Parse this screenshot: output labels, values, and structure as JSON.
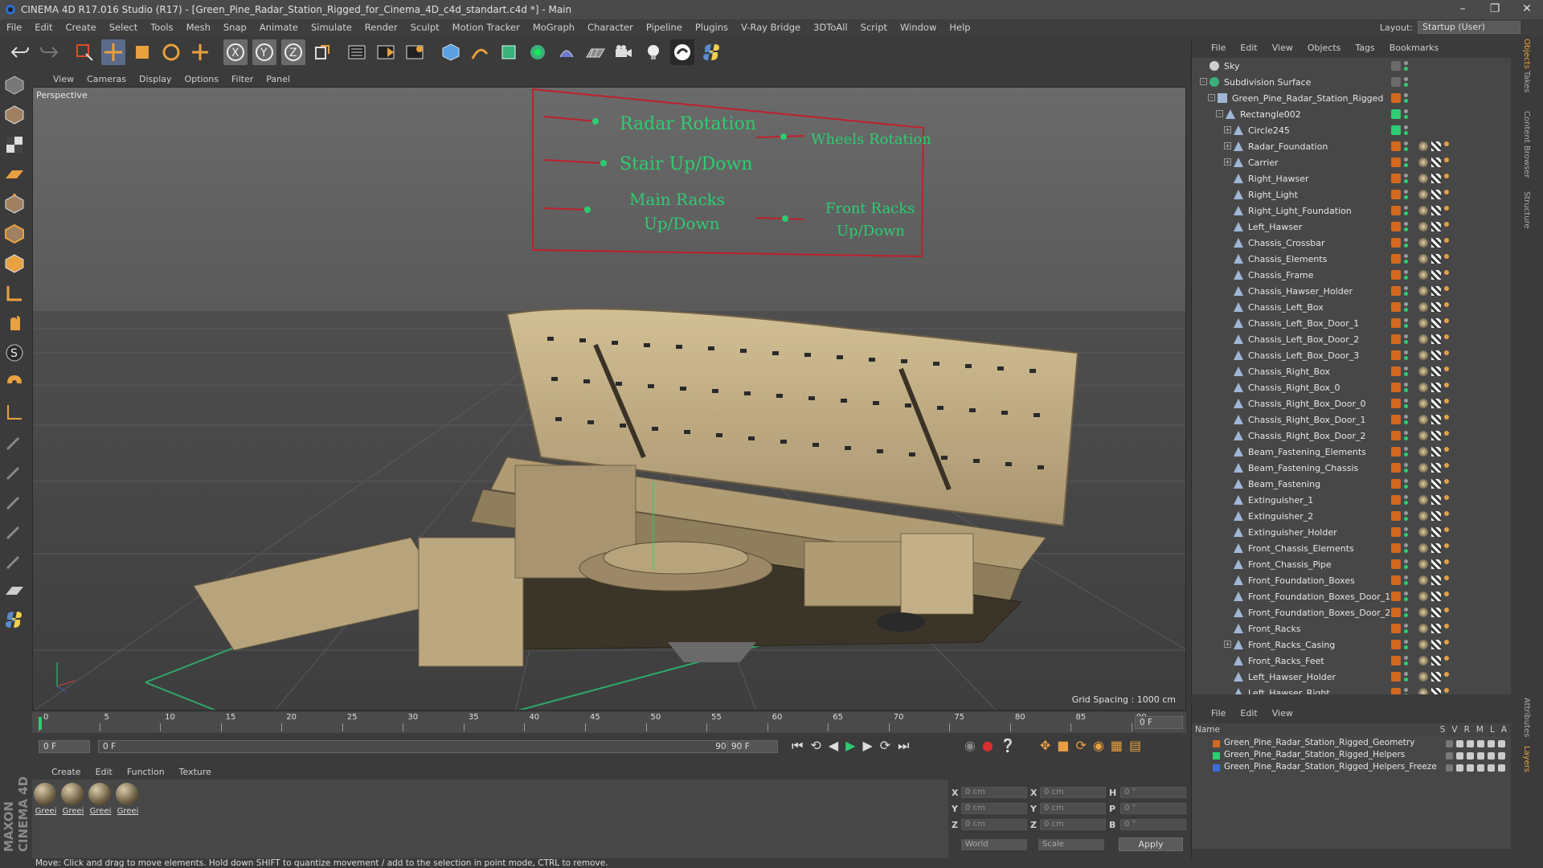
{
  "window": {
    "title": "CINEMA 4D R17.016 Studio (R17) - [Green_Pine_Radar_Station_Rigged_for_Cinema_4D_c4d_standart.c4d *] - Main"
  },
  "menu": [
    "File",
    "Edit",
    "Create",
    "Select",
    "Tools",
    "Mesh",
    "Snap",
    "Animate",
    "Simulate",
    "Render",
    "Sculpt",
    "Motion Tracker",
    "MoGraph",
    "Character",
    "Pipeline",
    "Plugins",
    "V-Ray Bridge",
    "3DToAll",
    "Script",
    "Window",
    "Help"
  ],
  "layout": {
    "label": "Layout:",
    "value": "Startup (User)"
  },
  "viewport": {
    "menu": [
      "View",
      "Cameras",
      "Display",
      "Options",
      "Filter",
      "Panel"
    ],
    "label": "Perspective",
    "grid_spacing": "Grid Spacing : 1000 cm",
    "controls": {
      "radar_rotation": "Radar Rotation",
      "wheels_rotation": "Wheels Rotation",
      "stair_updown": "Stair Up/Down",
      "main_racks_1": "Main Racks",
      "main_racks_2": "Up/Down",
      "front_racks_1": "Front Racks",
      "front_racks_2": "Up/Down"
    }
  },
  "timeline": {
    "ticks": [
      "0",
      "5",
      "10",
      "15",
      "20",
      "25",
      "30",
      "35",
      "40",
      "45",
      "50",
      "55",
      "60",
      "65",
      "70",
      "75",
      "80",
      "85",
      "90"
    ],
    "end_field": "0 F"
  },
  "transport": {
    "start": "0 F",
    "current": "0 F",
    "range_end": "90 F",
    "end": "90 F"
  },
  "materials": {
    "menu": [
      "Create",
      "Edit",
      "Function",
      "Texture"
    ],
    "items": [
      "Greei",
      "Greei",
      "Greei",
      "Greei"
    ]
  },
  "coords": {
    "x_pos": "0 cm",
    "y_pos": "0 cm",
    "z_pos": "0 cm",
    "x_size": "0 cm",
    "y_size": "0 cm",
    "z_size": "0 cm",
    "h": "0 °",
    "p": "0 °",
    "b": "0 °",
    "mode": "World",
    "size_mode": "Scale",
    "apply": "Apply",
    "labels": {
      "x": "X",
      "y": "Y",
      "z": "Z",
      "x2": "X",
      "y2": "Y",
      "z2": "Z",
      "h": "H",
      "p": "P",
      "b": "B"
    }
  },
  "objects": {
    "menu": [
      "File",
      "Edit",
      "View",
      "Objects",
      "Tags",
      "Bookmarks"
    ],
    "rows": [
      {
        "name": "Sky",
        "indent": 0,
        "color": "#6b6b6b",
        "type": "sky"
      },
      {
        "name": "Subdivision Surface",
        "indent": 0,
        "color": "#6b6b6b",
        "type": "subd",
        "expand": "-"
      },
      {
        "name": "Green_Pine_Radar_Station_Rigged",
        "indent": 1,
        "color": "#d2691e",
        "type": "null",
        "expand": "-"
      },
      {
        "name": "Rectangle002",
        "indent": 2,
        "color": "#2ecc71",
        "type": "spline",
        "expand": "-"
      },
      {
        "name": "Circle245",
        "indent": 3,
        "color": "#2ecc71",
        "type": "spline",
        "expand": "+"
      },
      {
        "name": "Radar_Foundation",
        "indent": 3,
        "color": "#d2691e",
        "type": "poly",
        "expand": "+"
      },
      {
        "name": "Carrier",
        "indent": 3,
        "color": "#d2691e",
        "type": "poly",
        "expand": "+"
      },
      {
        "name": "Right_Hawser",
        "indent": 3,
        "color": "#d2691e",
        "type": "poly"
      },
      {
        "name": "Right_Light",
        "indent": 3,
        "color": "#d2691e",
        "type": "poly"
      },
      {
        "name": "Right_Light_Foundation",
        "indent": 3,
        "color": "#d2691e",
        "type": "poly"
      },
      {
        "name": "Left_Hawser",
        "indent": 3,
        "color": "#d2691e",
        "type": "poly"
      },
      {
        "name": "Chassis_Crossbar",
        "indent": 3,
        "color": "#d2691e",
        "type": "poly"
      },
      {
        "name": "Chassis_Elements",
        "indent": 3,
        "color": "#d2691e",
        "type": "poly"
      },
      {
        "name": "Chassis_Frame",
        "indent": 3,
        "color": "#d2691e",
        "type": "poly"
      },
      {
        "name": "Chassis_Hawser_Holder",
        "indent": 3,
        "color": "#d2691e",
        "type": "poly"
      },
      {
        "name": "Chassis_Left_Box",
        "indent": 3,
        "color": "#d2691e",
        "type": "poly"
      },
      {
        "name": "Chassis_Left_Box_Door_1",
        "indent": 3,
        "color": "#d2691e",
        "type": "poly"
      },
      {
        "name": "Chassis_Left_Box_Door_2",
        "indent": 3,
        "color": "#d2691e",
        "type": "poly"
      },
      {
        "name": "Chassis_Left_Box_Door_3",
        "indent": 3,
        "color": "#d2691e",
        "type": "poly"
      },
      {
        "name": "Chassis_Right_Box",
        "indent": 3,
        "color": "#d2691e",
        "type": "poly"
      },
      {
        "name": "Chassis_Right_Box_0",
        "indent": 3,
        "color": "#d2691e",
        "type": "poly"
      },
      {
        "name": "Chassis_Right_Box_Door_0",
        "indent": 3,
        "color": "#d2691e",
        "type": "poly"
      },
      {
        "name": "Chassis_Right_Box_Door_1",
        "indent": 3,
        "color": "#d2691e",
        "type": "poly"
      },
      {
        "name": "Chassis_Right_Box_Door_2",
        "indent": 3,
        "color": "#d2691e",
        "type": "poly"
      },
      {
        "name": "Beam_Fastening_Elements",
        "indent": 3,
        "color": "#d2691e",
        "type": "poly"
      },
      {
        "name": "Beam_Fastening_Chassis",
        "indent": 3,
        "color": "#d2691e",
        "type": "poly"
      },
      {
        "name": "Beam_Fastening",
        "indent": 3,
        "color": "#d2691e",
        "type": "poly"
      },
      {
        "name": "Extinguisher_1",
        "indent": 3,
        "color": "#d2691e",
        "type": "poly"
      },
      {
        "name": "Extinguisher_2",
        "indent": 3,
        "color": "#d2691e",
        "type": "poly"
      },
      {
        "name": "Extinguisher_Holder",
        "indent": 3,
        "color": "#d2691e",
        "type": "poly"
      },
      {
        "name": "Front_Chassis_Elements",
        "indent": 3,
        "color": "#d2691e",
        "type": "poly"
      },
      {
        "name": "Front_Chassis_Pipe",
        "indent": 3,
        "color": "#d2691e",
        "type": "poly"
      },
      {
        "name": "Front_Foundation_Boxes",
        "indent": 3,
        "color": "#d2691e",
        "type": "poly"
      },
      {
        "name": "Front_Foundation_Boxes_Door_1",
        "indent": 3,
        "color": "#d2691e",
        "type": "poly"
      },
      {
        "name": "Front_Foundation_Boxes_Door_2",
        "indent": 3,
        "color": "#d2691e",
        "type": "poly"
      },
      {
        "name": "Front_Racks",
        "indent": 3,
        "color": "#d2691e",
        "type": "poly"
      },
      {
        "name": "Front_Racks_Casing",
        "indent": 3,
        "color": "#d2691e",
        "type": "poly",
        "expand": "+"
      },
      {
        "name": "Front_Racks_Feet",
        "indent": 3,
        "color": "#d2691e",
        "type": "poly"
      },
      {
        "name": "Left_Hawser_Holder",
        "indent": 3,
        "color": "#d2691e",
        "type": "poly"
      },
      {
        "name": "Left_Hawser_Right",
        "indent": 3,
        "color": "#d2691e",
        "type": "poly"
      }
    ]
  },
  "layers": {
    "menu": [
      "File",
      "Edit",
      "View"
    ],
    "header": {
      "name": "Name",
      "cols": [
        "S",
        "V",
        "R",
        "M",
        "L",
        "A"
      ]
    },
    "rows": [
      {
        "name": "Green_Pine_Radar_Station_Rigged_Geometry",
        "color": "#d2691e"
      },
      {
        "name": "Green_Pine_Radar_Station_Rigged_Helpers",
        "color": "#2ecc71"
      },
      {
        "name": "Green_Pine_Radar_Station_Rigged_Helpers_Freeze",
        "color": "#3a6ed8"
      }
    ]
  },
  "right_tabs": [
    "Objects",
    "Takes",
    "Content Browser",
    "Structure",
    "Attributes",
    "Layers"
  ],
  "status": "Move: Click and drag to move elements. Hold down SHIFT to quantize movement / add to the selection in point mode, CTRL to remove.",
  "brand": "MAXON CINEMA 4D",
  "colors": {
    "accent": "#2ecc71",
    "tag_orange": "#d2691e",
    "viewport_bg": "#5c5c5c",
    "panel": "#474747"
  }
}
